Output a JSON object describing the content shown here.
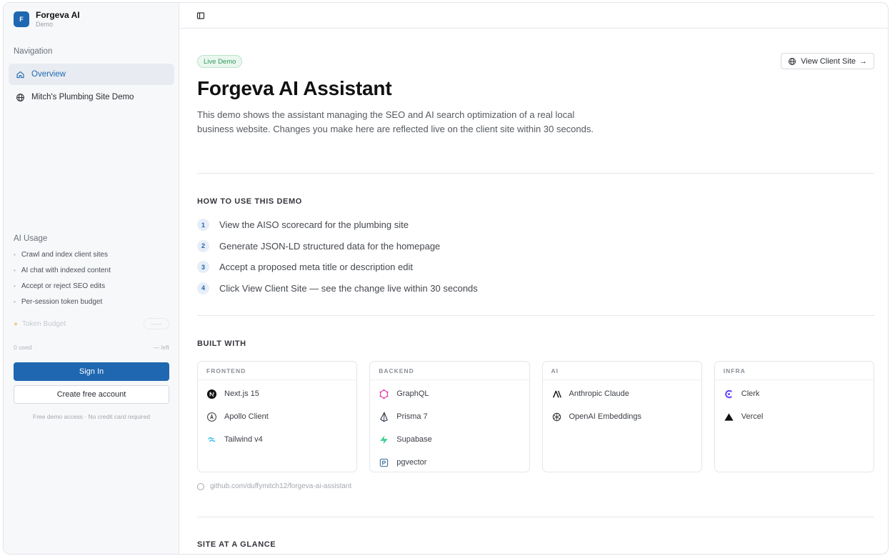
{
  "brand": {
    "logo_letter": "F",
    "name": "Forgeva AI",
    "subtitle": "Demo"
  },
  "sidebar": {
    "nav_heading": "Navigation",
    "nav_items": [
      {
        "label": "Overview",
        "icon": "home-icon",
        "active": true
      },
      {
        "label": "Mitch's Plumbing Site Demo",
        "icon": "globe-icon",
        "active": false
      }
    ],
    "usage_heading": "AI Usage",
    "usage_items": [
      "Crawl and index client sites",
      "AI chat with indexed content",
      "Accept or reject SEO edits",
      "Per-session token budget"
    ],
    "token_budget_label": "Token Budget",
    "token_pill": "——",
    "used_label": "0 used",
    "left_label": "— left",
    "sign_in_label": "Sign In",
    "create_account_label": "Create free account",
    "fine_print": "Free demo access · No credit card required"
  },
  "header": {
    "badge": "Live Demo",
    "view_site_label": "View Client Site",
    "view_site_arrow": "→",
    "title": "Forgeva AI Assistant",
    "lead": "This demo shows the assistant managing the SEO and AI search optimization of a real local business website. Changes you make here are reflected live on the client site within 30 seconds."
  },
  "how_to": {
    "title": "HOW TO USE THIS DEMO",
    "steps": [
      {
        "num": "1",
        "text": "View the AISO scorecard for the plumbing site"
      },
      {
        "num": "2",
        "text": "Generate JSON-LD structured data for the homepage"
      },
      {
        "num": "3",
        "text": "Accept a proposed meta title or description edit"
      },
      {
        "num": "4",
        "text": "Click View Client Site — see the change live within 30 seconds"
      }
    ]
  },
  "built_with": {
    "title": "BUILT WITH",
    "groups": [
      {
        "heading": "FRONTEND",
        "items": [
          {
            "label": "Next.js 15",
            "icon": "nextjs-icon"
          },
          {
            "label": "Apollo Client",
            "icon": "apollo-icon"
          },
          {
            "label": "Tailwind v4",
            "icon": "tailwind-icon"
          }
        ]
      },
      {
        "heading": "BACKEND",
        "items": [
          {
            "label": "GraphQL",
            "icon": "graphql-icon"
          },
          {
            "label": "Prisma 7",
            "icon": "prisma-icon"
          },
          {
            "label": "Supabase",
            "icon": "supabase-icon"
          },
          {
            "label": "pgvector",
            "icon": "pgvector-icon"
          }
        ]
      },
      {
        "heading": "AI",
        "items": [
          {
            "label": "Anthropic Claude",
            "icon": "anthropic-icon"
          },
          {
            "label": "OpenAI Embeddings",
            "icon": "openai-icon"
          }
        ]
      },
      {
        "heading": "INFRA",
        "items": [
          {
            "label": "Clerk",
            "icon": "clerk-icon"
          },
          {
            "label": "Vercel",
            "icon": "vercel-icon"
          }
        ]
      }
    ],
    "repo": "github.com/duffymitch12/forgeva-ai-assistant"
  },
  "glance": {
    "title": "SITE AT A GLANCE"
  },
  "colors": {
    "accent": "#1f67b1",
    "badge_green": "#2f9a5a"
  }
}
